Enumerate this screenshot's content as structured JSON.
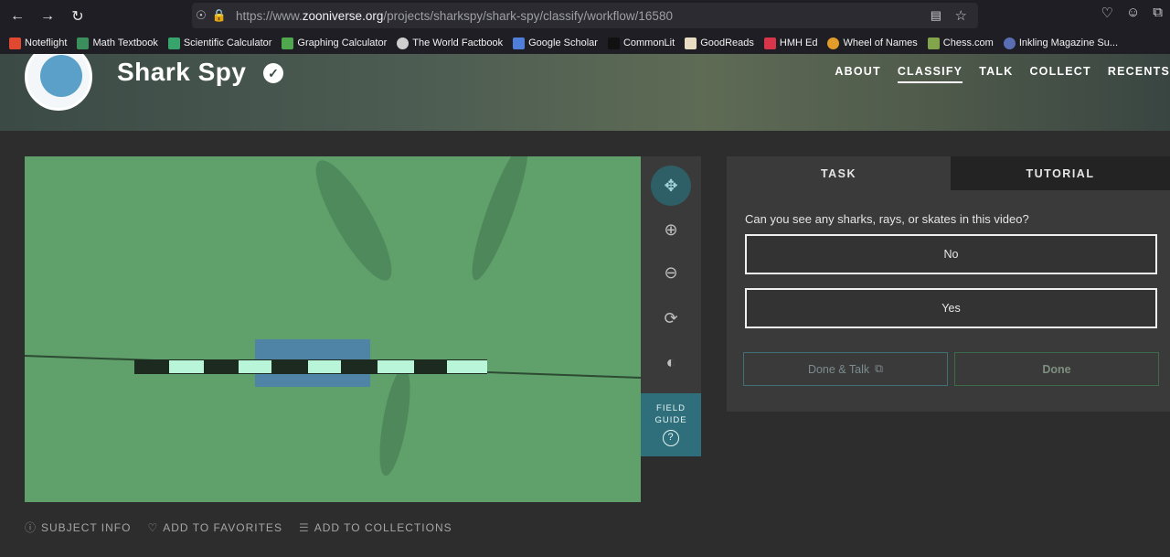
{
  "browser": {
    "url_prefix": "https://www.",
    "url_host": "zooniverse.org",
    "url_path": "/projects/sharkspy/shark-spy/classify/workflow/16580"
  },
  "bookmarks": [
    {
      "label": "Noteflight",
      "color": "#e0482f"
    },
    {
      "label": "Math Textbook",
      "color": "#3a8f5c"
    },
    {
      "label": "Scientific Calculator",
      "color": "#37a56b"
    },
    {
      "label": "Graphing Calculator",
      "color": "#4fa84d"
    },
    {
      "label": "The World Factbook",
      "color": "#cfcfcf"
    },
    {
      "label": "Google Scholar",
      "color": "#4f7fd9"
    },
    {
      "label": "CommonLit",
      "color": "#111111"
    },
    {
      "label": "GoodReads",
      "color": "#e8dcc3"
    },
    {
      "label": "HMH Ed",
      "color": "#d8344a"
    },
    {
      "label": "Wheel of Names",
      "color": "#e39b2a"
    },
    {
      "label": "Chess.com",
      "color": "#82a44a"
    },
    {
      "label": "Inkling Magazine Su...",
      "color": "#5a6fb3"
    }
  ],
  "project": {
    "title": "Shark Spy",
    "nav": [
      "ABOUT",
      "CLASSIFY",
      "TALK",
      "COLLECT",
      "RECENTS"
    ]
  },
  "field_guide": {
    "line1": "FIELD",
    "line2": "GUIDE",
    "icon": "?"
  },
  "meta": {
    "subject_info": "SUBJECT INFO",
    "add_favorites": "ADD TO FAVORITES",
    "add_collections": "ADD TO COLLECTIONS"
  },
  "task": {
    "tab_task": "TASK",
    "tab_tutorial": "TUTORIAL",
    "question": "Can you see any sharks, rays, or skates in this video?",
    "answers": [
      "No",
      "Yes"
    ],
    "done_talk": "Done & Talk",
    "done": "Done"
  }
}
